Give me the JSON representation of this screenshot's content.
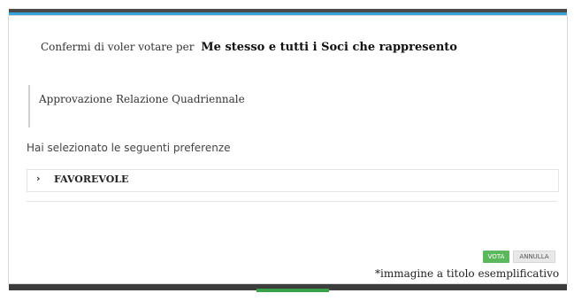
{
  "dialog": {
    "confirm_prefix": "Confermi di voler votare per",
    "confirm_subject": "Me stesso e tutti i Soci che rappresento",
    "question": "Approvazione Relazione Quadriennale",
    "preferences_heading": "Hai selezionato le seguenti preferenze",
    "choice": {
      "chevron": "›",
      "label": "FAVOREVOLE"
    },
    "buttons": {
      "vote": "VOTA",
      "cancel": "ANNULLA"
    }
  },
  "disclaimer": "*immagine a titolo esemplificativo",
  "colors": {
    "accent_top": "#34a3dc",
    "vote_button": "#5cb85c",
    "frame": "#3d3d3d"
  }
}
